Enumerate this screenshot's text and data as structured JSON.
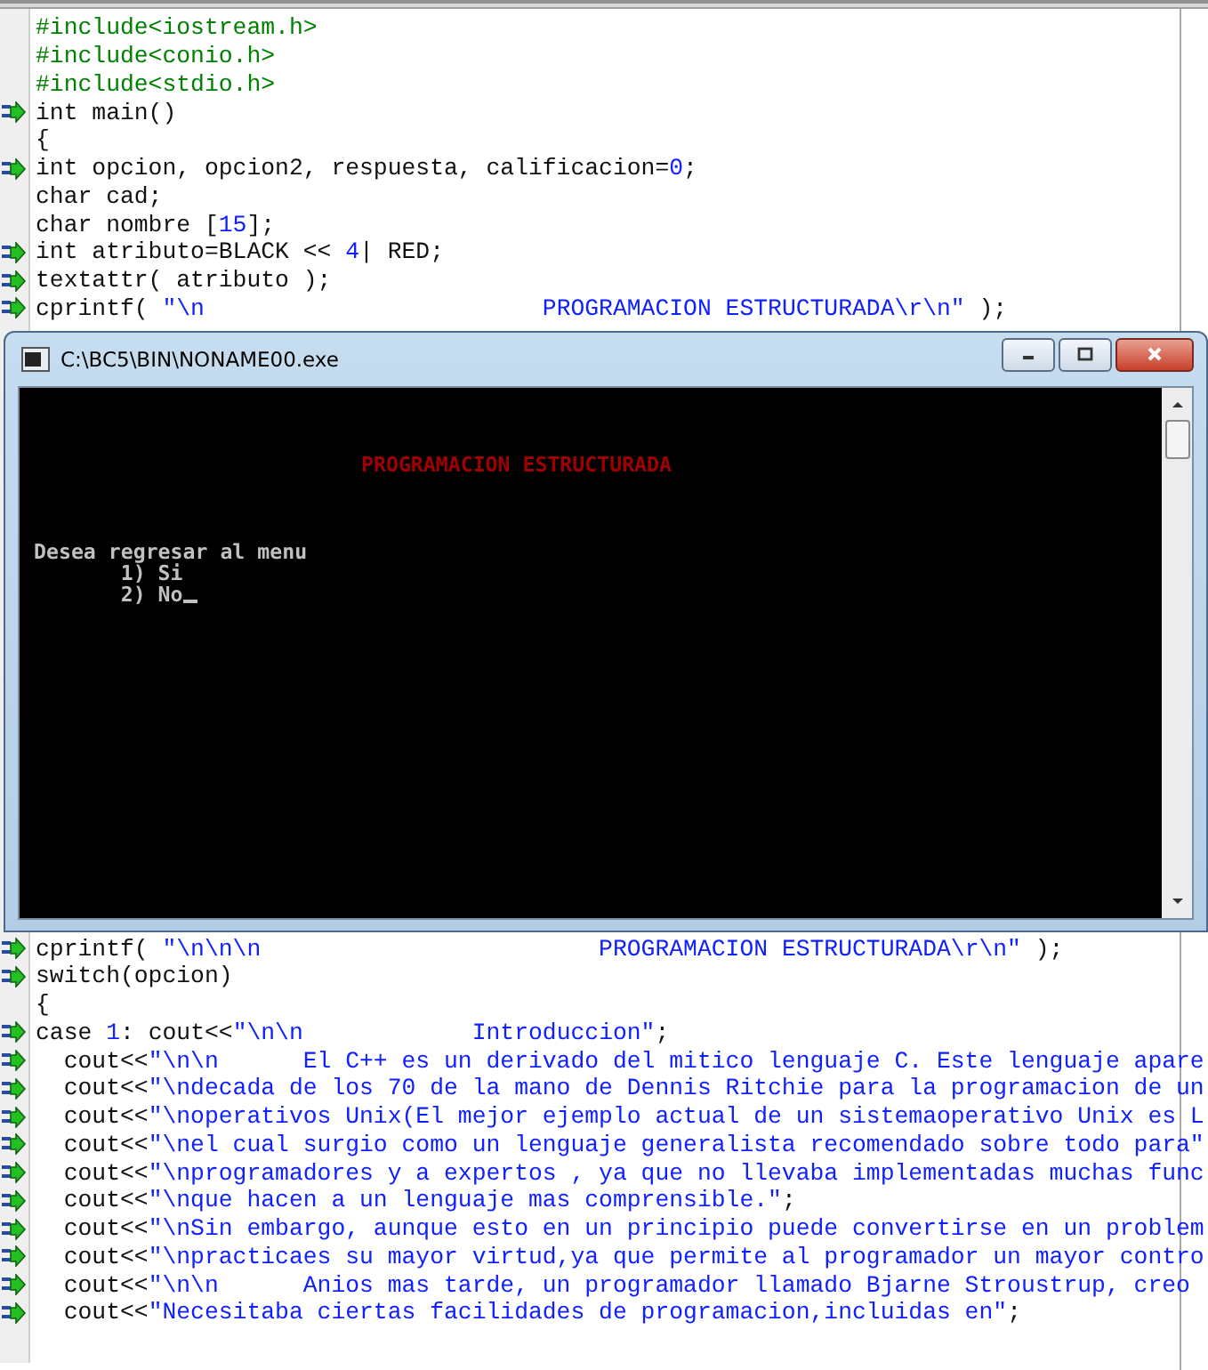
{
  "editor": {
    "lines_top": [
      {
        "marker": false,
        "segments": [
          {
            "kind": "pre",
            "text": "#include<iostream.h>"
          }
        ]
      },
      {
        "marker": false,
        "segments": [
          {
            "kind": "pre",
            "text": "#include<conio.h>"
          }
        ]
      },
      {
        "marker": false,
        "segments": [
          {
            "kind": "pre",
            "text": "#include<stdio.h>"
          }
        ]
      },
      {
        "marker": true,
        "segments": [
          {
            "kind": "plain",
            "text": "int main()"
          }
        ]
      },
      {
        "marker": false,
        "segments": [
          {
            "kind": "plain",
            "text": "{"
          }
        ]
      },
      {
        "marker": true,
        "segments": [
          {
            "kind": "plain",
            "text": "int opcion, opcion2, respuesta, calificacion="
          },
          {
            "kind": "num",
            "text": "0"
          },
          {
            "kind": "plain",
            "text": ";"
          }
        ]
      },
      {
        "marker": false,
        "segments": [
          {
            "kind": "plain",
            "text": "char cad;"
          }
        ]
      },
      {
        "marker": false,
        "segments": [
          {
            "kind": "plain",
            "text": "char nombre ["
          },
          {
            "kind": "num",
            "text": "15"
          },
          {
            "kind": "plain",
            "text": "];"
          }
        ]
      },
      {
        "marker": true,
        "segments": [
          {
            "kind": "plain",
            "text": "int atributo=BLACK << "
          },
          {
            "kind": "num",
            "text": "4"
          },
          {
            "kind": "plain",
            "text": "| RED;"
          }
        ]
      },
      {
        "marker": true,
        "segments": [
          {
            "kind": "plain",
            "text": "textattr( atributo );"
          }
        ]
      },
      {
        "marker": true,
        "segments": [
          {
            "kind": "plain",
            "text": "cprintf( "
          },
          {
            "kind": "str",
            "text": "\"\\n                        PROGRAMACION ESTRUCTURADA\\r\\n\""
          },
          {
            "kind": "plain",
            "text": " );"
          }
        ]
      }
    ],
    "lines_bottom": [
      {
        "marker": true,
        "segments": [
          {
            "kind": "plain",
            "text": "cprintf( "
          },
          {
            "kind": "str",
            "text": "\"\\n\\n\\n                        PROGRAMACION ESTRUCTURADA\\r\\n\""
          },
          {
            "kind": "plain",
            "text": " );"
          }
        ]
      },
      {
        "marker": true,
        "segments": [
          {
            "kind": "plain",
            "text": "switch(opcion)"
          }
        ]
      },
      {
        "marker": false,
        "segments": [
          {
            "kind": "plain",
            "text": "{"
          }
        ]
      },
      {
        "marker": true,
        "segments": [
          {
            "kind": "plain",
            "text": "case "
          },
          {
            "kind": "num",
            "text": "1"
          },
          {
            "kind": "plain",
            "text": ": cout<<"
          },
          {
            "kind": "str",
            "text": "\"\\n\\n            Introduccion\""
          },
          {
            "kind": "plain",
            "text": ";"
          }
        ]
      },
      {
        "marker": true,
        "segments": [
          {
            "kind": "plain",
            "text": "  cout<<"
          },
          {
            "kind": "str",
            "text": "\"\\n\\n      El C++ es un derivado del mitico lenguaje C. Este lenguaje apare"
          }
        ]
      },
      {
        "marker": true,
        "segments": [
          {
            "kind": "plain",
            "text": "  cout<<"
          },
          {
            "kind": "str",
            "text": "\"\\ndecada de los 70 de la mano de Dennis Ritchie para la programacion de un"
          }
        ]
      },
      {
        "marker": true,
        "segments": [
          {
            "kind": "plain",
            "text": "  cout<<"
          },
          {
            "kind": "str",
            "text": "\"\\noperativos Unix(El mejor ejemplo actual de un sistemaoperativo Unix es L"
          }
        ]
      },
      {
        "marker": true,
        "segments": [
          {
            "kind": "plain",
            "text": "  cout<<"
          },
          {
            "kind": "str",
            "text": "\"\\nel cual surgio como un lenguaje generalista recomendado sobre todo para\""
          }
        ]
      },
      {
        "marker": true,
        "segments": [
          {
            "kind": "plain",
            "text": "  cout<<"
          },
          {
            "kind": "str",
            "text": "\"\\nprogramadores y a expertos , ya que no llevaba implementadas muchas func"
          }
        ]
      },
      {
        "marker": true,
        "segments": [
          {
            "kind": "plain",
            "text": "  cout<<"
          },
          {
            "kind": "str",
            "text": "\"\\nque hacen a un lenguaje mas comprensible.\""
          },
          {
            "kind": "plain",
            "text": ";"
          }
        ]
      },
      {
        "marker": true,
        "segments": [
          {
            "kind": "plain",
            "text": "  cout<<"
          },
          {
            "kind": "str",
            "text": "\"\\nSin embargo, aunque esto en un principio puede convertirse en un problem"
          }
        ]
      },
      {
        "marker": true,
        "segments": [
          {
            "kind": "plain",
            "text": "  cout<<"
          },
          {
            "kind": "str",
            "text": "\"\\npracticaes su mayor virtud,ya que permite al programador un mayor contro"
          }
        ]
      },
      {
        "marker": true,
        "segments": [
          {
            "kind": "plain",
            "text": "  cout<<"
          },
          {
            "kind": "str",
            "text": "\"\\n\\n      Anios mas tarde, un programador llamado Bjarne Stroustrup, creo"
          }
        ]
      },
      {
        "marker": true,
        "segments": [
          {
            "kind": "plain",
            "text": "  cout<<"
          },
          {
            "kind": "str",
            "text": "\"Necesitaba ciertas facilidades de programacion,incluidas en\""
          },
          {
            "kind": "plain",
            "text": ";"
          }
        ]
      }
    ]
  },
  "console": {
    "title": "C:\\BC5\\BIN\\NONAME00.exe",
    "lines": [
      {
        "kind": "banner",
        "text": "PROGRAMACION ESTRUCTURADA"
      },
      {
        "kind": "prompt",
        "text": "Desea regresar al menu"
      },
      {
        "kind": "option",
        "text": "       1) Si"
      },
      {
        "kind": "option",
        "text": "       2) No"
      }
    ]
  }
}
